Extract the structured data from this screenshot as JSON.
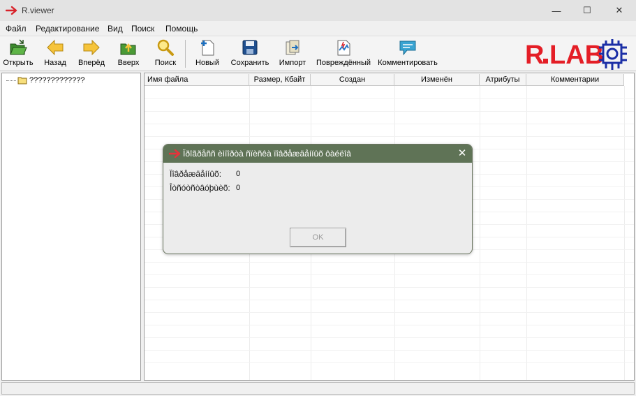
{
  "window": {
    "title": "R.viewer",
    "minimize_glyph": "—",
    "maximize_glyph": "☐",
    "close_glyph": "✕"
  },
  "menu": [
    "Файл",
    "Редактирование",
    "Вид",
    "Поиск",
    "Помощь"
  ],
  "toolbar": {
    "open": "Открыть",
    "back": "Назад",
    "forward": "Вперёд",
    "up": "Вверх",
    "search": "Поиск",
    "new": "Новый",
    "save": "Сохранить",
    "import": "Импорт",
    "damaged": "Повреждённый",
    "comment": "Комментировать"
  },
  "logo": {
    "text": "R.LAB",
    "accent_color": "#e41e26",
    "emblem_color": "#1b2fa6"
  },
  "tree": {
    "root_label": "?????????????"
  },
  "columns": [
    "Имя файла",
    "Размер, Кбайт",
    "Создан",
    "Изменён",
    "Атрибуты",
    "Комментарии"
  ],
  "dialog": {
    "title": "Ïðîãðåññ èìïîðòà ñïèñêà ïîâðåæäåííûõ ôàéëîâ",
    "rows": [
      {
        "label": "Ïîâðåæäåííûõ:",
        "value": "0"
      },
      {
        "label": "Îòñóòñòâóþùèõ:",
        "value": "0"
      }
    ],
    "ok_label": "OK",
    "close_glyph": "✕",
    "title_color": "#5f7356"
  }
}
